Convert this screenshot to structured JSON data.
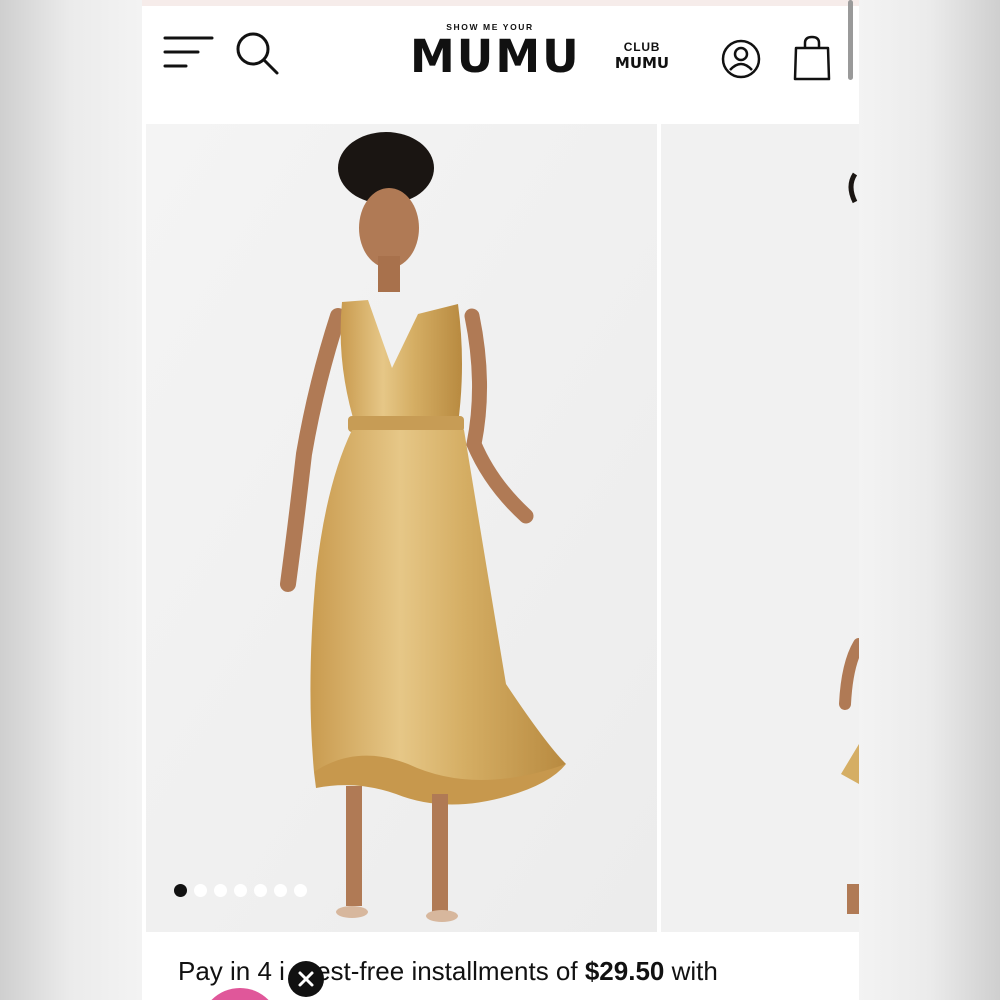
{
  "header": {
    "logo_top": "SHOW ME YOUR",
    "logo_main": "MUMU",
    "club_top": "CLUB",
    "club_bottom": "MUMU",
    "icons": [
      "menu-icon",
      "search-icon",
      "account-icon",
      "shopping-bag-icon"
    ]
  },
  "gallery": {
    "total_images": 7,
    "active_index": 0,
    "dress_color": "#d8b46c"
  },
  "installments": {
    "prefix": "Pay in 4 i",
    "mid": "erest-free installments of ",
    "amount": "$29.50",
    "suffix": " with"
  },
  "colors": {
    "accent_pink": "#e0579a",
    "text": "#111111"
  }
}
